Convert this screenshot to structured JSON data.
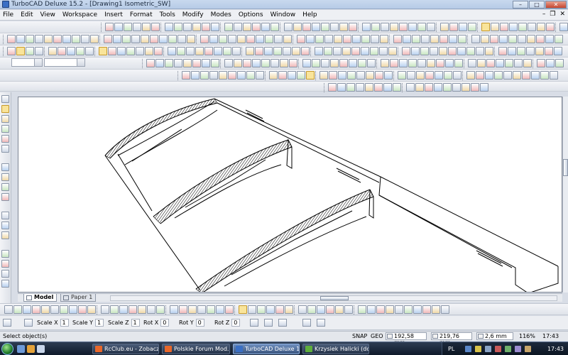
{
  "window": {
    "title": "TurboCAD Deluxe 15.2 - [Drawing1 Isometric_SW]",
    "controls": {
      "minimize": "–",
      "maximize": "□",
      "close": "✕"
    },
    "mdi_controls": {
      "minimize": "–",
      "restore": "❐",
      "close": "✕"
    }
  },
  "menu": [
    "File",
    "Edit",
    "View",
    "Workspace",
    "Insert",
    "Format",
    "Tools",
    "Modify",
    "Modes",
    "Options",
    "Window",
    "Help"
  ],
  "canvas": {
    "tabs": [
      {
        "label": "Model",
        "active": true
      },
      {
        "label": "Paper 1",
        "active": false
      }
    ]
  },
  "inspector": {
    "fields": [
      {
        "label": "Scale X",
        "value": "1"
      },
      {
        "label": "Scale Y",
        "value": "1"
      },
      {
        "label": "Scale Z",
        "value": "1"
      },
      {
        "label": "Rot X",
        "value": "0"
      },
      {
        "label": "Rot Y",
        "value": "0"
      },
      {
        "label": "Rot Z",
        "value": "0"
      }
    ]
  },
  "status": {
    "prompt": "Select object(s)",
    "snap": "SNAP",
    "geo": "GEO",
    "x": "192,58 mm",
    "y": "219,76 mm",
    "z": "2,6 mm",
    "zoom": "116%",
    "time": "17:43"
  },
  "taskbar": {
    "tasks": [
      {
        "label": "RcClub.eu - Zobacz ...",
        "active": false
      },
      {
        "label": "Polskie Forum Mod...",
        "active": false
      },
      {
        "label": "TurboCAD Deluxe 1...",
        "active": true
      },
      {
        "label": "Krzysiek Halicki (dos...",
        "active": false
      }
    ],
    "language": "PL",
    "clock": "17:43"
  },
  "colors": {
    "titlebar": "#c9d9ee",
    "taskbar": "#1b2638",
    "canvas": "#ffffff",
    "active_tool": "#f9e49a"
  }
}
